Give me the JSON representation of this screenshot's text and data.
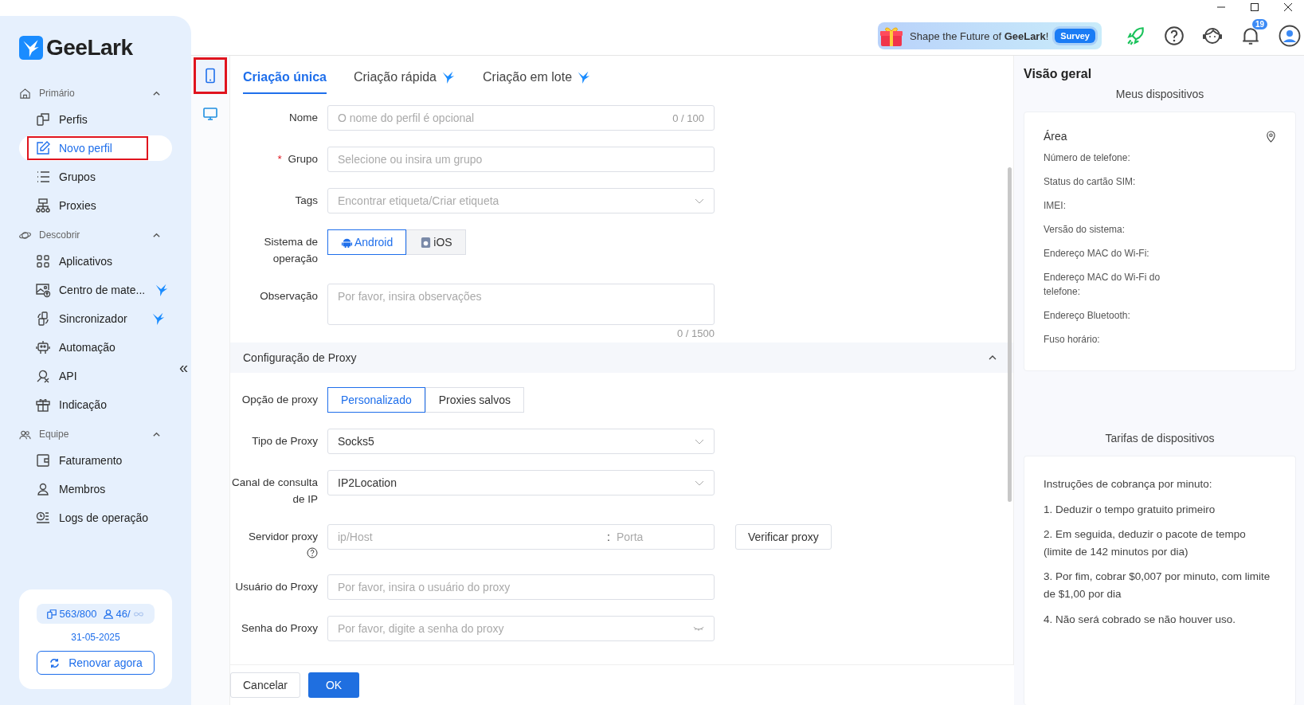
{
  "sidebar": {
    "logo": "GeeLark",
    "collapse": "«",
    "sections": [
      {
        "title": "Primário",
        "kind": "home",
        "expanded": true,
        "items": [
          {
            "label": "Perfis",
            "kind": "profiles",
            "selected": false,
            "highlighted": false,
            "new": false
          },
          {
            "label": "Novo perfil",
            "kind": "edit",
            "selected": true,
            "highlighted": true,
            "new": false
          },
          {
            "label": "Grupos",
            "kind": "list",
            "selected": false,
            "highlighted": false,
            "new": false
          },
          {
            "label": "Proxies",
            "kind": "network",
            "selected": false,
            "highlighted": false,
            "new": false
          }
        ]
      },
      {
        "title": "Descobrir",
        "kind": "planet",
        "expanded": true,
        "items": [
          {
            "label": "Aplicativos",
            "kind": "apps",
            "selected": false,
            "highlighted": false,
            "new": false
          },
          {
            "label": "Centro de mate...",
            "kind": "image",
            "selected": false,
            "highlighted": false,
            "new": true
          },
          {
            "label": "Sincronizador",
            "kind": "sync",
            "selected": false,
            "highlighted": false,
            "new": true
          },
          {
            "label": "Automação",
            "kind": "robot",
            "selected": false,
            "highlighted": false,
            "new": false
          },
          {
            "label": "API",
            "kind": "api",
            "selected": false,
            "highlighted": false,
            "new": false
          },
          {
            "label": "Indicação",
            "kind": "gift",
            "selected": false,
            "highlighted": false,
            "new": false
          }
        ]
      },
      {
        "title": "Equipe",
        "kind": "team",
        "expanded": true,
        "items": [
          {
            "label": "Faturamento",
            "kind": "wallet",
            "selected": false,
            "highlighted": false,
            "new": false
          },
          {
            "label": "Membros",
            "kind": "user",
            "selected": false,
            "highlighted": false,
            "new": false
          },
          {
            "label": "Logs de operação",
            "kind": "log",
            "selected": false,
            "highlighted": false,
            "new": false
          }
        ]
      }
    ],
    "quota": {
      "profiles": "563/800",
      "members": "46/",
      "date": "31-05-2025",
      "renew": "Renovar agora"
    }
  },
  "header": {
    "banner": "Shape the Future of **GeeLark**!",
    "survey": "Survey",
    "notifications": "19"
  },
  "device_tabs": [
    {
      "kind": "phone",
      "selected": true,
      "highlighted": true
    },
    {
      "kind": "desktop",
      "selected": false,
      "highlighted": false
    }
  ],
  "tabs": [
    {
      "label": "Criação única",
      "selected": true,
      "new": false
    },
    {
      "label": "Criação rápida",
      "selected": false,
      "new": true
    },
    {
      "label": "Criação em lote",
      "selected": false,
      "new": true
    }
  ],
  "form": [
    {
      "kind": "text",
      "label": "Nome",
      "placeholder": "O nome do perfil é opcional",
      "counter": "0 / 100"
    },
    {
      "kind": "text",
      "label": "Grupo",
      "required_mark": "*",
      "placeholder": "Selecione ou insira um grupo"
    },
    {
      "kind": "select",
      "label": "Tags",
      "placeholder": "Encontrar etiqueta/Criar etiqueta"
    },
    {
      "kind": "segmented",
      "label": "Sistema de operação",
      "options": [
        {
          "label": "Android",
          "selected": true
        },
        {
          "label": "iOS",
          "selected": false
        }
      ]
    },
    {
      "kind": "textarea",
      "label": "Observação",
      "placeholder": "Por favor, insira observações",
      "counter": "0 / 1500"
    }
  ],
  "proxy": {
    "title": "Configuração de Proxy",
    "expanded": true,
    "fields": [
      {
        "kind": "segmented",
        "label": "Opção de proxy",
        "options": [
          {
            "label": "Personalizado",
            "selected": true
          },
          {
            "label": "Proxies salvos",
            "selected": false
          }
        ]
      },
      {
        "kind": "select",
        "label": "Tipo de Proxy",
        "value": "Socks5"
      },
      {
        "kind": "select",
        "label": "Canal de consulta de IP",
        "value": "IP2Location"
      },
      {
        "kind": "server",
        "label": "Servidor proxy",
        "placeholder": "ip/Host",
        "port_placeholder": "Porta",
        "separator": ":",
        "button": "Verificar proxy"
      },
      {
        "kind": "text",
        "label": "Usuário do Proxy",
        "placeholder": "Por favor, insira o usuário do proxy"
      },
      {
        "kind": "password",
        "label": "Senha do Proxy",
        "placeholder": "Por favor, digite a senha do proxy"
      }
    ]
  },
  "footer": {
    "cancel": "Cancelar",
    "ok": "OK"
  },
  "overview": {
    "title": "Visão geral",
    "devices_title": "Meus dispositivos",
    "area": "Área",
    "fields": [
      "Número de telefone:",
      "Status do cartão SIM:",
      "IMEI:",
      "Versão do sistema:",
      "Endereço MAC do Wi-Fi:",
      "Endereço MAC do Wi-Fi do telefone:",
      "Endereço Bluetooth:",
      "Fuso horário:"
    ],
    "rates_title": "Tarifas de dispositivos",
    "rates": [
      "Instruções de cobrança por minuto:",
      "1. Deduzir o tempo gratuito primeiro",
      "2. Em seguida, deduzir o pacote de tempo (limite de 142 minutos por dia)",
      "3. Por fim, cobrar $0,007 por minuto, com limite de $1,00 por dia",
      "4. Não será cobrado se não houver uso."
    ]
  }
}
